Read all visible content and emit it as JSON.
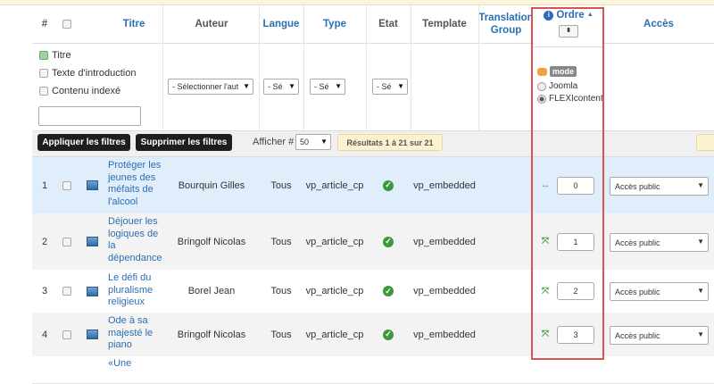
{
  "headers": {
    "num": "#",
    "titre": "Titre",
    "auteur": "Auteur",
    "langue": "Langue",
    "type": "Type",
    "etat": "Etat",
    "template": "Template",
    "translation_group": "Translation Group",
    "ordre": "Ordre",
    "acces": "Accès"
  },
  "filters": {
    "search_in": [
      {
        "label": "Titre",
        "checked": true
      },
      {
        "label": "Texte d'introduction",
        "checked": false
      },
      {
        "label": "Contenu indexé",
        "checked": false
      }
    ],
    "search_value": "",
    "auteur_select": "- Sélectionner l'aut",
    "langue_select": "- Sé",
    "type_select": "- Sé",
    "etat_select": "- Sé",
    "order_mode_badge": "mode",
    "order_modes": [
      {
        "label": "Joomla",
        "selected": false
      },
      {
        "label": "FLEXIcontent",
        "selected": true
      }
    ]
  },
  "toolbar": {
    "apply_label": "Appliquer les filtres",
    "clear_label": "Supprimer les filtres",
    "show_label": "Afficher #",
    "show_value": "50",
    "results_label": "Résultats 1 à 21 sur 21"
  },
  "rows": [
    {
      "num": "1",
      "title_lines": [
        "Protéger les",
        "jeunes des",
        "méfaits de",
        "l'alcool"
      ],
      "author": "Bourquin Gilles",
      "language": "Tous",
      "type": "vp_article_cp",
      "template": "vp_embedded",
      "order": "0",
      "access": "Accès public"
    },
    {
      "num": "2",
      "title_lines": [
        "Déjouer les",
        "logiques de",
        "la",
        "dépendance"
      ],
      "author": "Bringolf Nicolas",
      "language": "Tous",
      "type": "vp_article_cp",
      "template": "vp_embedded",
      "order": "1",
      "access": "Accès public"
    },
    {
      "num": "3",
      "title_lines": [
        "Le défi du",
        "pluralisme",
        "religieux"
      ],
      "author": "Borel Jean",
      "language": "Tous",
      "type": "vp_article_cp",
      "template": "vp_embedded",
      "order": "2",
      "access": "Accès public"
    },
    {
      "num": "4",
      "title_lines": [
        "Ode à sa",
        "majesté le",
        "piano"
      ],
      "author": "Bringolf Nicolas",
      "language": "Tous",
      "type": "vp_article_cp",
      "template": "vp_embedded",
      "order": "3",
      "access": "Accès public"
    },
    {
      "num": "",
      "title_lines": [
        "«Une"
      ],
      "author": "",
      "language": "",
      "type": "",
      "template": "",
      "order": "",
      "access": ""
    }
  ],
  "colors": {
    "link": "#2a6fb3",
    "row_highlight": "#dfeefa",
    "row_alt": "#f3f3f3",
    "ok_green": "#3a9a3a",
    "annotation_red": "#d9534f",
    "dark_button": "#1e1e1e"
  },
  "icons": {
    "info": "info-icon",
    "sort_up": "sort-asc-icon",
    "published": "check-circle-icon",
    "drag": "move-arrows-icon",
    "item_type": "document-icon"
  }
}
